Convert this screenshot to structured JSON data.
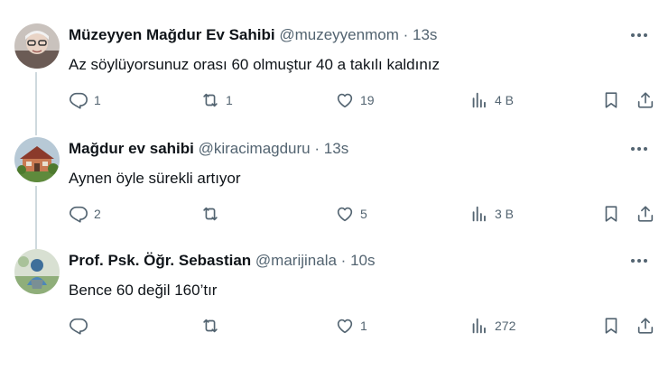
{
  "tweets": [
    {
      "name": "Müzeyyen Mağdur Ev Sahibi",
      "handle": "@muzeyyenmom",
      "time": "13s",
      "text": "Az söylüyorsunuz orası 60 olmuştur 40 a takılı kaldınız",
      "replies": "1",
      "retweets": "1",
      "likes": "19",
      "views": "4 B"
    },
    {
      "name": "Mağdur ev sahibi",
      "handle": "@kiracimagduru",
      "time": "13s",
      "text": "Aynen öyle sürekli artıyor",
      "replies": "2",
      "retweets": "",
      "likes": "5",
      "views": "3 B"
    },
    {
      "name": "Prof. Psk. Öğr. Sebastian",
      "handle": "@marijinala",
      "time": "10s",
      "text": "Bence 60 değil 160’tır",
      "replies": "",
      "retweets": "",
      "likes": "1",
      "views": "272"
    }
  ],
  "separator": "·",
  "colors": {
    "text": "#0f1419",
    "muted": "#536471",
    "thread_line": "#cfd9de"
  },
  "icons": [
    "reply-icon",
    "retweet-icon",
    "like-icon",
    "views-icon",
    "bookmark-icon",
    "share-icon",
    "more-icon"
  ]
}
